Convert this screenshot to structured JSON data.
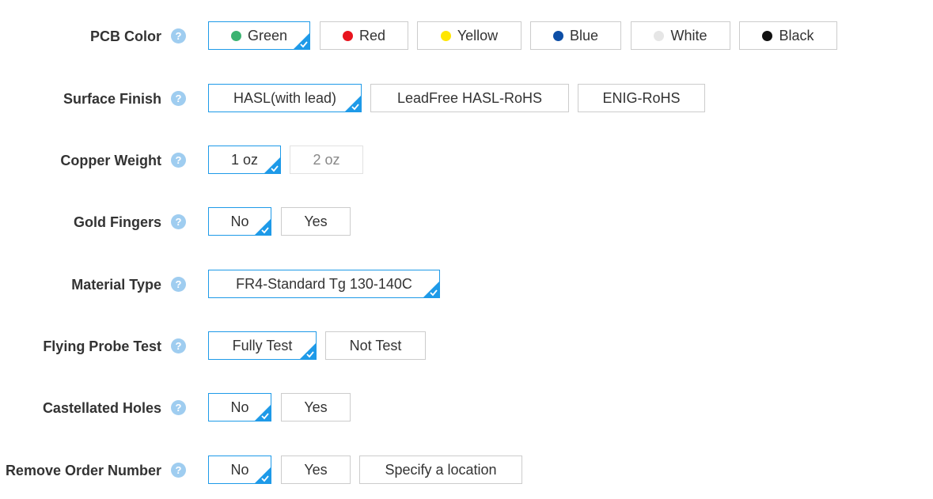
{
  "rows": [
    {
      "label": "PCB Color",
      "options": [
        {
          "text": "Green",
          "selected": true,
          "color": "#3cb371"
        },
        {
          "text": "Red",
          "color": "#e8141e"
        },
        {
          "text": "Yellow",
          "color": "#ffe600"
        },
        {
          "text": "Blue",
          "color": "#0d4ea6"
        },
        {
          "text": "White",
          "color": "#e6e6e6"
        },
        {
          "text": "Black",
          "color": "#111111"
        }
      ]
    },
    {
      "label": "Surface Finish",
      "options": [
        {
          "text": "HASL(with lead)",
          "selected": true
        },
        {
          "text": "LeadFree HASL-RoHS"
        },
        {
          "text": "ENIG-RoHS"
        }
      ]
    },
    {
      "label": "Copper Weight",
      "options": [
        {
          "text": "1 oz",
          "selected": true
        },
        {
          "text": "2 oz",
          "disabled": true
        }
      ]
    },
    {
      "label": "Gold Fingers",
      "options": [
        {
          "text": "No",
          "selected": true
        },
        {
          "text": "Yes"
        }
      ]
    },
    {
      "label": "Material Type",
      "options": [
        {
          "text": "FR4-Standard Tg 130-140C",
          "selected": true
        }
      ]
    },
    {
      "label": "Flying Probe Test",
      "options": [
        {
          "text": "Fully Test",
          "selected": true
        },
        {
          "text": "Not Test"
        }
      ]
    },
    {
      "label": "Castellated Holes",
      "options": [
        {
          "text": "No",
          "selected": true
        },
        {
          "text": "Yes"
        }
      ]
    },
    {
      "label": "Remove Order Number",
      "options": [
        {
          "text": "No",
          "selected": true
        },
        {
          "text": "Yes"
        },
        {
          "text": "Specify a location"
        }
      ]
    }
  ],
  "help_icon": "?",
  "accent_color": "#1e9ae8"
}
